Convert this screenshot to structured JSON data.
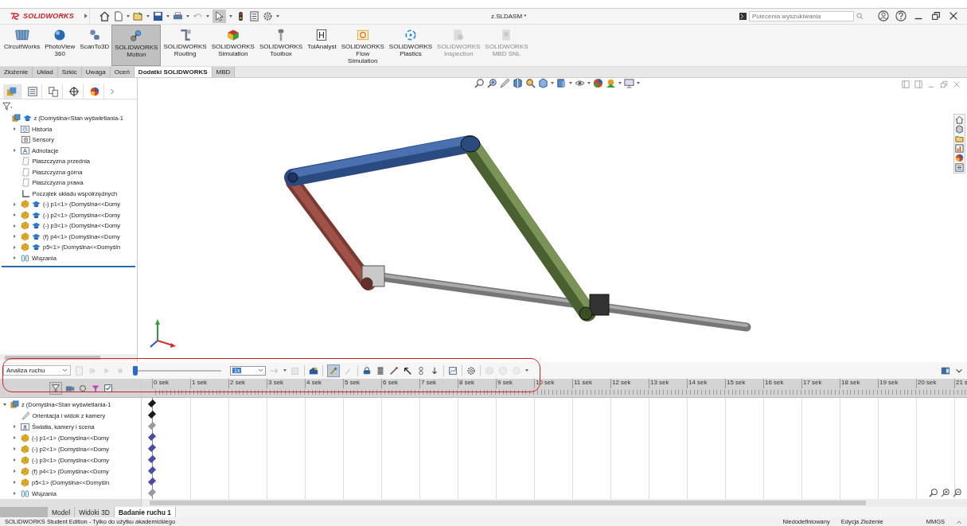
{
  "title_bar": {
    "app": "SOLIDWORKS",
    "title": "z.SLDASM *",
    "search": {
      "placeholder": "Polecenia wyszukiwania"
    }
  },
  "ribbon": [
    {
      "label": "CircuitWorks",
      "kind": "circuit",
      "selected": false,
      "disabled": false
    },
    {
      "label": "PhotoView\n360",
      "kind": "sphere",
      "selected": false,
      "disabled": false
    },
    {
      "label": "ScanTo3D",
      "kind": "scanner",
      "selected": false,
      "disabled": false
    },
    {
      "label": "SOLIDWORKS\nMotion",
      "kind": "motion",
      "selected": true,
      "disabled": false
    },
    {
      "label": "SOLIDWORKS\nRouting",
      "kind": "routing",
      "selected": false,
      "disabled": false
    },
    {
      "label": "SOLIDWORKS\nSimulation",
      "kind": "simulation",
      "selected": false,
      "disabled": false
    },
    {
      "label": "SOLIDWORKS\nToolbox",
      "kind": "toolbox",
      "selected": false,
      "disabled": false
    },
    {
      "label": "TolAnalyst",
      "kind": "tolerance",
      "selected": false,
      "disabled": false
    },
    {
      "label": "SOLIDWORKS\nFlow\nSimulation",
      "kind": "flow",
      "selected": false,
      "disabled": false
    },
    {
      "label": "SOLIDWORKS\nPlastics",
      "kind": "plastics",
      "selected": false,
      "disabled": false
    },
    {
      "label": "SOLIDWORKS\nInspection",
      "kind": "inspection",
      "selected": false,
      "disabled": true
    },
    {
      "label": "SOLIDWORKS\nMBD SNL",
      "kind": "mbd",
      "selected": false,
      "disabled": true
    }
  ],
  "command_tabs": [
    {
      "label": "Złożenie",
      "selected": false
    },
    {
      "label": "Układ",
      "selected": false
    },
    {
      "label": "Szkic",
      "selected": false
    },
    {
      "label": "Uwaga",
      "selected": false
    },
    {
      "label": "Oceń",
      "selected": false
    },
    {
      "label": "Dodatki SOLIDWORKS",
      "selected": true
    },
    {
      "label": "MBD",
      "selected": false
    }
  ],
  "feature_tree": {
    "items": [
      {
        "label": "z  (Domyślna<Stan wyświetlania-1",
        "kind": "assembly",
        "config": true,
        "children": [
          {
            "label": "Historia",
            "kind": "history",
            "expanded": false
          },
          {
            "label": "Sensory",
            "kind": "sensor"
          },
          {
            "label": "Adnotacje",
            "kind": "annotation",
            "expanded": false
          },
          {
            "label": "Płaszczyzna przednia",
            "kind": "plane"
          },
          {
            "label": "Płaszczyzna górna",
            "kind": "plane"
          },
          {
            "label": "Płaszczyzna prawa",
            "kind": "plane"
          },
          {
            "label": "Początek układu współrzędnych",
            "kind": "origin"
          },
          {
            "label": "(-) p1<1> (Domyślna<<Domy",
            "kind": "part",
            "config": true,
            "expanded": false
          },
          {
            "label": "(-) p2<1> (Domyślna<<Domy",
            "kind": "part",
            "config": true,
            "expanded": false
          },
          {
            "label": "(-) p3<1> (Domyślna<<Domy",
            "kind": "part",
            "config": true,
            "expanded": false
          },
          {
            "label": "(f) p4<1> (Domyślna<<Domy",
            "kind": "part",
            "config": true,
            "expanded": false
          },
          {
            "label": "p5<1> (Domyślna<<Domyśln",
            "kind": "part",
            "config": true,
            "expanded": false
          },
          {
            "label": "Wiązania",
            "kind": "mates",
            "expanded": false
          }
        ]
      }
    ]
  },
  "motion_toolbar": {
    "study_type": "Analiza ruchu",
    "playback": {
      "level": 0.02
    },
    "speed": "1x"
  },
  "timeline": {
    "ticks": [
      "0 sek",
      "1 sek",
      "2 sek",
      "3 sek",
      "4 sek",
      "5 sek",
      "6 sek",
      "7 sek",
      "8 sek",
      "9 sek",
      "10 sek",
      "11 sek",
      "12 sek",
      "13 sek",
      "14 sek",
      "15 sek",
      "16 sek",
      "17 sek",
      "18 sek",
      "19 sek",
      "20 sek",
      "21 s"
    ],
    "items": [
      {
        "label": "z  (Domyślna<Stan wyświetlania-1",
        "kind": "assembly",
        "expanded": true,
        "color": "#1a1a1a",
        "children": [
          {
            "label": "Orientacja i widok z kamery",
            "kind": "camera",
            "color": "#1a1a1a"
          },
          {
            "label": "Światła, kamery i scena",
            "kind": "lights",
            "expanded": false,
            "color": "#9a9a9a"
          },
          {
            "label": "(-) p1<1> (Domyślna<<Domy",
            "kind": "part",
            "expanded": false,
            "color": "#4a4aa8"
          },
          {
            "label": "(-) p2<1> (Domyślna<<Domy",
            "kind": "part",
            "expanded": false,
            "color": "#4a4aa8"
          },
          {
            "label": "(-) p3<1> (Domyślna<<Domy",
            "kind": "part",
            "expanded": false,
            "color": "#4a4aa8"
          },
          {
            "label": "(f) p4<1> (Domyślna<<Domy",
            "kind": "part",
            "expanded": false,
            "color": "#4a4aa8"
          },
          {
            "label": "p5<1> (Domyślna<<Domyśln",
            "kind": "part",
            "expanded": false,
            "color": "#4a4aa8"
          },
          {
            "label": "Wiązania",
            "kind": "mates",
            "expanded": false,
            "color": "#9a9a9a"
          }
        ]
      }
    ]
  },
  "bottom_tabs": [
    {
      "label": "Model",
      "selected": false
    },
    {
      "label": "Widoki 3D",
      "selected": false
    },
    {
      "label": "Badanie ruchu 1",
      "selected": true
    }
  ],
  "status_bar": {
    "edition": "SOLIDWORKS Student Edition - Tylko do użytku akademickiego",
    "items": [
      "Niedodefiniowany",
      "Edycja Złożenie",
      "MMGS"
    ]
  }
}
